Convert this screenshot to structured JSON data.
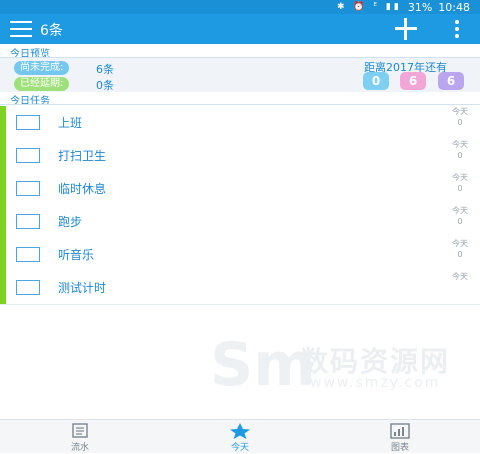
{
  "status_bar": {
    "icons": "✱ ⏰ ᴱ ▮▮",
    "battery": "31%",
    "time": "10:48"
  },
  "app_bar": {
    "title": "6条"
  },
  "preview": {
    "section_label": "今日预览",
    "unfinished_label": "尚未完成:",
    "unfinished_count": "6条",
    "overdue_label": "已经延期:",
    "overdue_count": "0条",
    "countdown_title": "距离2017年还有",
    "countdown_digits": [
      "0",
      "6",
      "6"
    ]
  },
  "tasks_section_label": "今日任务",
  "tasks": [
    {
      "name": "上班",
      "day": "今天",
      "sub": "0"
    },
    {
      "name": "打扫卫生",
      "day": "今天",
      "sub": "0"
    },
    {
      "name": "临时休息",
      "day": "今天",
      "sub": "0"
    },
    {
      "name": "跑步",
      "day": "今天",
      "sub": "0"
    },
    {
      "name": "听音乐",
      "day": "今天",
      "sub": "0"
    },
    {
      "name": "测试计时",
      "day": "今天",
      "sub": ""
    }
  ],
  "watermark": {
    "mark": "Sm",
    "text": "数码资源网",
    "url": "www.smzy.com"
  },
  "bottom_nav": [
    {
      "label": "流水",
      "icon": "ledger-icon"
    },
    {
      "label": "今天",
      "icon": "star-icon"
    },
    {
      "label": "图表",
      "icon": "chart-icon"
    }
  ],
  "colors": {
    "primary": "#1e9ae2",
    "accent_green": "#7ed321",
    "pill_blue": "#74c7ef",
    "pill_green": "#9ee07a"
  }
}
